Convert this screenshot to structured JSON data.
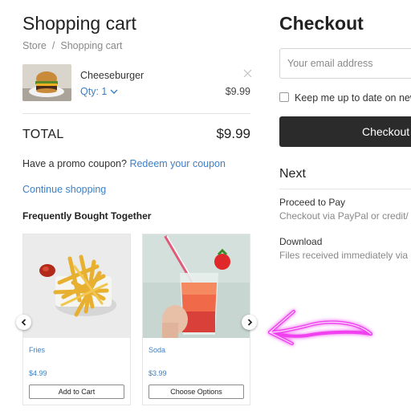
{
  "cart": {
    "title": "Shopping cart",
    "breadcrumb": [
      "Store",
      "Shopping cart"
    ],
    "breadcrumb_sep": "/",
    "item": {
      "name": "Cheeseburger",
      "qty_label": "Qty: 1",
      "price": "$9.99"
    },
    "total_label": "TOTAL",
    "total_value": "$9.99",
    "promo_text": "Have a promo coupon?",
    "promo_link": "Redeem your coupon",
    "continue_link": "Continue shopping",
    "fbt_title": "Frequently Bought Together",
    "products": [
      {
        "name": "Fries",
        "price": "$4.99",
        "button": "Add to Cart"
      },
      {
        "name": "Soda",
        "price": "$3.99",
        "button": "Choose Options"
      }
    ]
  },
  "checkout": {
    "title": "Checkout",
    "email_placeholder": "Your email address",
    "keep_label": "Keep me up to date on new",
    "button_label": "Checkout"
  },
  "next": {
    "title": "Next",
    "steps": [
      {
        "title": "Proceed to Pay",
        "subtitle": "Checkout via PayPal or credit/"
      },
      {
        "title": "Download",
        "subtitle": "Files received immediately via"
      }
    ]
  },
  "icons": {
    "remove": "close-icon",
    "qty": "chevron-down-icon",
    "prev": "chevron-left-icon",
    "next": "chevron-right-icon"
  },
  "colors": {
    "link": "#3d7fc4",
    "button_dark": "#2b2b2b",
    "annotation_arrow": "#e020e0"
  }
}
